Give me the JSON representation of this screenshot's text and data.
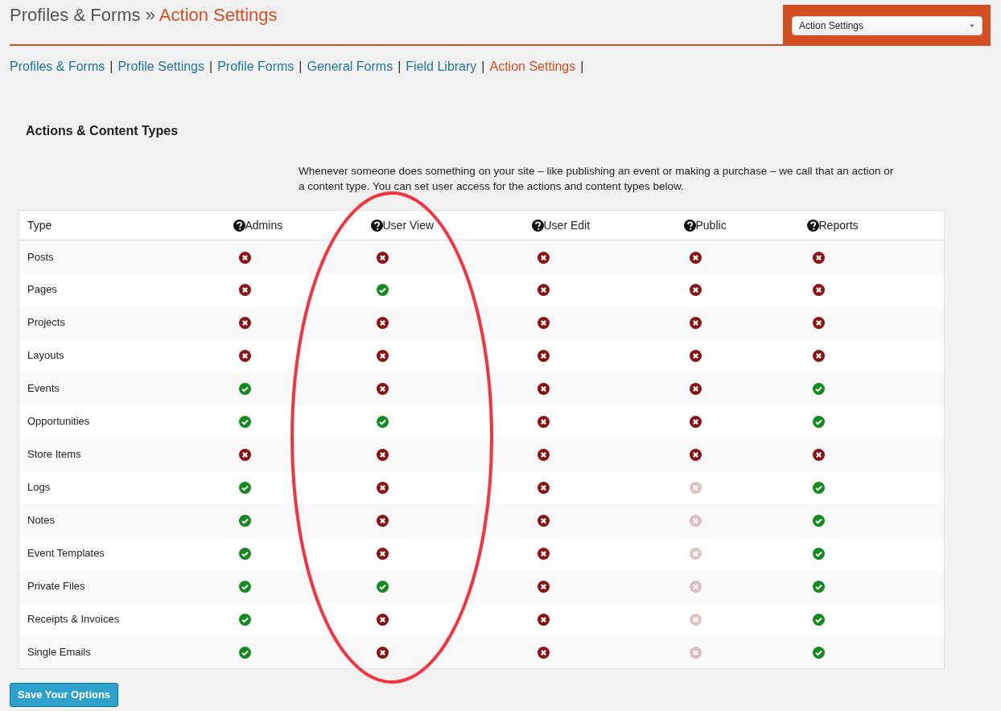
{
  "page_title": {
    "section": "Profiles & Forms",
    "separator": "»",
    "current": "Action Settings"
  },
  "view_select": {
    "value": "Action Settings"
  },
  "nav_links": [
    {
      "label": "Profiles & Forms",
      "selected": false
    },
    {
      "label": "Profile Settings",
      "selected": false
    },
    {
      "label": "Profile Forms",
      "selected": false
    },
    {
      "label": "General Forms",
      "selected": false
    },
    {
      "label": "Field Library",
      "selected": false
    },
    {
      "label": "Action Settings",
      "selected": true
    }
  ],
  "nav_separator": "|",
  "section_heading": "Actions & Content Types",
  "description": "Whenever someone does something on your site – like publishing an event or making a purchase – we call that an action or a content type. You can set user access for the actions and content types below.",
  "table": {
    "columns": [
      {
        "label": "Type",
        "help": false
      },
      {
        "label": "Admins",
        "help": true
      },
      {
        "label": "User View",
        "help": true
      },
      {
        "label": "User Edit",
        "help": true
      },
      {
        "label": "Public",
        "help": true
      },
      {
        "label": "Reports",
        "help": true
      }
    ],
    "rows": [
      {
        "type": "Posts",
        "cells": [
          {
            "allowed": false,
            "disabled": false
          },
          {
            "allowed": false,
            "disabled": false
          },
          {
            "allowed": false,
            "disabled": false
          },
          {
            "allowed": false,
            "disabled": false
          },
          {
            "allowed": false,
            "disabled": false
          }
        ]
      },
      {
        "type": "Pages",
        "cells": [
          {
            "allowed": false,
            "disabled": false
          },
          {
            "allowed": true,
            "disabled": false
          },
          {
            "allowed": false,
            "disabled": false
          },
          {
            "allowed": false,
            "disabled": false
          },
          {
            "allowed": false,
            "disabled": false
          }
        ]
      },
      {
        "type": "Projects",
        "cells": [
          {
            "allowed": false,
            "disabled": false
          },
          {
            "allowed": false,
            "disabled": false
          },
          {
            "allowed": false,
            "disabled": false
          },
          {
            "allowed": false,
            "disabled": false
          },
          {
            "allowed": false,
            "disabled": false
          }
        ]
      },
      {
        "type": "Layouts",
        "cells": [
          {
            "allowed": false,
            "disabled": false
          },
          {
            "allowed": false,
            "disabled": false
          },
          {
            "allowed": false,
            "disabled": false
          },
          {
            "allowed": false,
            "disabled": false
          },
          {
            "allowed": false,
            "disabled": false
          }
        ]
      },
      {
        "type": "Events",
        "cells": [
          {
            "allowed": true,
            "disabled": false
          },
          {
            "allowed": false,
            "disabled": false
          },
          {
            "allowed": false,
            "disabled": false
          },
          {
            "allowed": false,
            "disabled": false
          },
          {
            "allowed": true,
            "disabled": false
          }
        ]
      },
      {
        "type": "Opportunities",
        "cells": [
          {
            "allowed": true,
            "disabled": false
          },
          {
            "allowed": true,
            "disabled": false
          },
          {
            "allowed": false,
            "disabled": false
          },
          {
            "allowed": false,
            "disabled": false
          },
          {
            "allowed": true,
            "disabled": false
          }
        ]
      },
      {
        "type": "Store Items",
        "cells": [
          {
            "allowed": false,
            "disabled": false
          },
          {
            "allowed": false,
            "disabled": false
          },
          {
            "allowed": false,
            "disabled": false
          },
          {
            "allowed": false,
            "disabled": false
          },
          {
            "allowed": false,
            "disabled": false
          }
        ]
      },
      {
        "type": "Logs",
        "cells": [
          {
            "allowed": true,
            "disabled": false
          },
          {
            "allowed": false,
            "disabled": false
          },
          {
            "allowed": false,
            "disabled": false
          },
          {
            "allowed": false,
            "disabled": true
          },
          {
            "allowed": true,
            "disabled": false
          }
        ]
      },
      {
        "type": "Notes",
        "cells": [
          {
            "allowed": true,
            "disabled": false
          },
          {
            "allowed": false,
            "disabled": false
          },
          {
            "allowed": false,
            "disabled": false
          },
          {
            "allowed": false,
            "disabled": true
          },
          {
            "allowed": true,
            "disabled": false
          }
        ]
      },
      {
        "type": "Event Templates",
        "cells": [
          {
            "allowed": true,
            "disabled": false
          },
          {
            "allowed": false,
            "disabled": false
          },
          {
            "allowed": false,
            "disabled": false
          },
          {
            "allowed": false,
            "disabled": true
          },
          {
            "allowed": true,
            "disabled": false
          }
        ]
      },
      {
        "type": "Private Files",
        "cells": [
          {
            "allowed": true,
            "disabled": false
          },
          {
            "allowed": true,
            "disabled": false
          },
          {
            "allowed": false,
            "disabled": false
          },
          {
            "allowed": false,
            "disabled": true
          },
          {
            "allowed": true,
            "disabled": false
          }
        ]
      },
      {
        "type": "Receipts & Invoices",
        "cells": [
          {
            "allowed": true,
            "disabled": false
          },
          {
            "allowed": false,
            "disabled": false
          },
          {
            "allowed": false,
            "disabled": false
          },
          {
            "allowed": false,
            "disabled": true
          },
          {
            "allowed": true,
            "disabled": false
          }
        ]
      },
      {
        "type": "Single Emails",
        "cells": [
          {
            "allowed": true,
            "disabled": false
          },
          {
            "allowed": false,
            "disabled": false
          },
          {
            "allowed": false,
            "disabled": false
          },
          {
            "allowed": false,
            "disabled": true
          },
          {
            "allowed": true,
            "disabled": false
          }
        ]
      }
    ]
  },
  "save_button": {
    "label": "Save Your Options"
  },
  "annotations": [
    {
      "kind": "ellipse",
      "color": "#f5333f"
    }
  ]
}
